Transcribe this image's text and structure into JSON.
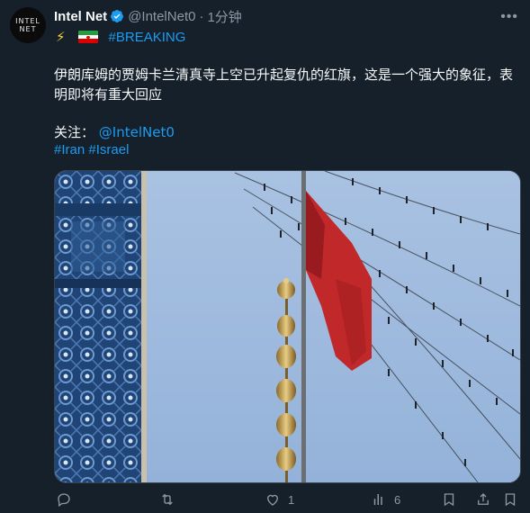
{
  "author": {
    "avatar_line1": "INTEL",
    "avatar_line2": "NET",
    "name": "Intel Net",
    "handle": "@IntelNet0",
    "separator": "·",
    "time": "1分钟"
  },
  "tagline": {
    "hashtag": "#BREAKING"
  },
  "post": {
    "text": "伊朗库姆的贾姆卡兰清真寺上空已升起复仇的红旗，这是一个强大的象征，表明即将有重大回应",
    "follow_label": "关注：",
    "follow_handle": "@IntelNet0",
    "hashtags": [
      "#Iran",
      "#Israel"
    ]
  },
  "media": {
    "description_colors": {
      "sky": "#9cb8dd",
      "flag": "#c0282a",
      "tile": "#2a4f80"
    }
  },
  "actions": {
    "reply_count": "",
    "repost_count": "",
    "like_count": "1",
    "views_count": "6"
  },
  "colors": {
    "accent": "#1d9bf0",
    "background": "#15202b",
    "muted": "#8b98a5"
  }
}
